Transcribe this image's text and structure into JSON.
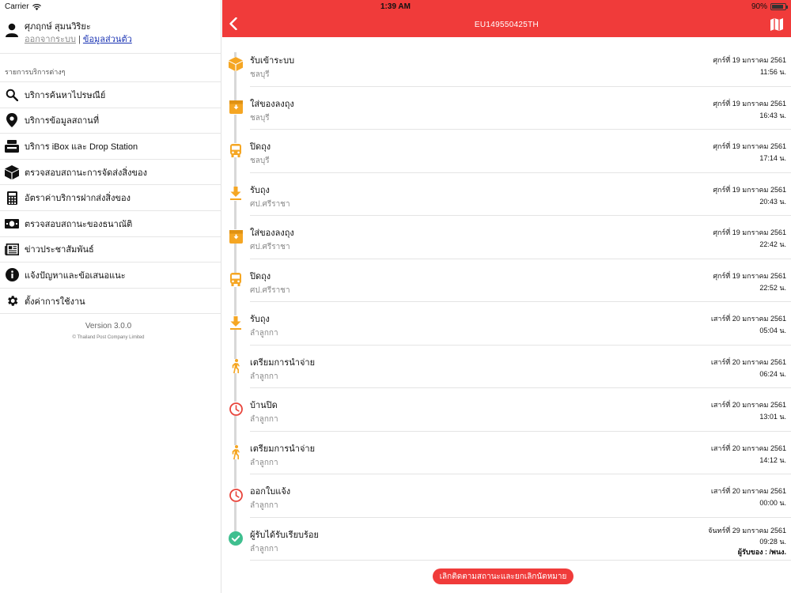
{
  "status_bar": {
    "carrier": "Carrier",
    "time": "1:39 AM",
    "battery": "90%"
  },
  "sidebar": {
    "user_name": "ศุภฤกษ์ สุมนวิริยะ",
    "logout_label": "ออกจากระบบ",
    "separator": " | ",
    "profile_label": "ข้อมูลส่วนตัว",
    "section_label": "รายการบริการต่างๆ",
    "items": [
      {
        "label": "บริการค้นหาไปรษณีย์",
        "icon": "search-icon"
      },
      {
        "label": "บริการข้อมูลสถานที่",
        "icon": "location-pin-icon"
      },
      {
        "label": "บริการ iBox และ Drop Station",
        "icon": "ibox-icon"
      },
      {
        "label": "ตรวจสอบสถานะการจัดส่งสิ่งของ",
        "icon": "parcel-box-icon"
      },
      {
        "label": "อัตราค่าบริการฝากส่งสิ่งของ",
        "icon": "calculator-icon"
      },
      {
        "label": "ตรวจสอบสถานะของธนาณัติ",
        "icon": "money-order-icon"
      },
      {
        "label": "ข่าวประชาสัมพันธ์",
        "icon": "newspaper-icon"
      },
      {
        "label": "แจ้งปัญหาและข้อเสนอแนะ",
        "icon": "info-icon"
      },
      {
        "label": "ตั้งค่าการใช้งาน",
        "icon": "gear-icon"
      }
    ],
    "version": "Version 3.0.0",
    "copyright": "© Thailand Post Company Limited"
  },
  "header": {
    "tracking_number": "EU149550425TH"
  },
  "events": [
    {
      "title": "รับเข้าระบบ",
      "location": "ชลบุรี",
      "date": "ศุกร์ที่ 19 มกราคม 2561",
      "time": "11:56 น.",
      "icon": "parcel-box-icon",
      "extra": ""
    },
    {
      "title": "ใส่ของลงถุง",
      "location": "ชลบุรี",
      "date": "ศุกร์ที่ 19 มกราคม 2561",
      "time": "16:43 น.",
      "icon": "bag-in-icon",
      "extra": ""
    },
    {
      "title": "ปิดถุง",
      "location": "ชลบุรี",
      "date": "ศุกร์ที่ 19 มกราคม 2561",
      "time": "17:14 น.",
      "icon": "bus-icon",
      "extra": ""
    },
    {
      "title": "รับถุง",
      "location": "ศป.ศรีราชา",
      "date": "ศุกร์ที่ 19 มกราคม 2561",
      "time": "20:43 น.",
      "icon": "download-arrow-icon",
      "extra": ""
    },
    {
      "title": "ใส่ของลงถุง",
      "location": "ศป.ศรีราชา",
      "date": "ศุกร์ที่ 19 มกราคม 2561",
      "time": "22:42 น.",
      "icon": "bag-in-icon",
      "extra": ""
    },
    {
      "title": "ปิดถุง",
      "location": "ศป.ศรีราชา",
      "date": "ศุกร์ที่ 19 มกราคม 2561",
      "time": "22:52 น.",
      "icon": "bus-icon",
      "extra": ""
    },
    {
      "title": "รับถุง",
      "location": "ลำลูกกา",
      "date": "เสาร์ที่ 20 มกราคม 2561",
      "time": "05:04 น.",
      "icon": "download-arrow-icon",
      "extra": ""
    },
    {
      "title": "เตรียมการนำจ่าย",
      "location": "ลำลูกกา",
      "date": "เสาร์ที่ 20 มกราคม 2561",
      "time": "06:24 น.",
      "icon": "walking-person-icon",
      "extra": ""
    },
    {
      "title": "บ้านปิด",
      "location": "ลำลูกกา",
      "date": "เสาร์ที่ 20 มกราคม 2561",
      "time": "13:01 น.",
      "icon": "clock-icon",
      "extra": ""
    },
    {
      "title": "เตรียมการนำจ่าย",
      "location": "ลำลูกกา",
      "date": "เสาร์ที่ 20 มกราคม 2561",
      "time": "14:12 น.",
      "icon": "walking-person-icon",
      "extra": ""
    },
    {
      "title": "ออกใบแจ้ง",
      "location": "ลำลูกกา",
      "date": "เสาร์ที่ 20 มกราคม 2561",
      "time": "00:00 น.",
      "icon": "clock-icon",
      "extra": ""
    },
    {
      "title": "ผู้รับได้รับเรียบร้อย",
      "location": "ลำลูกกา",
      "date": "จันทร์ที่ 29 มกราคม 2561",
      "time": "09:28 น.",
      "icon": "check-circle-icon",
      "extra": "ผู้รับของ : /พนง."
    }
  ],
  "action_button": {
    "label": "เลิกติดตามสถานะและยกเลิกนัดหมาย"
  },
  "colors": {
    "brand_red": "#f03b3a",
    "orange": "#f5a623",
    "red": "#e8453c",
    "green": "#3fbf8f"
  }
}
